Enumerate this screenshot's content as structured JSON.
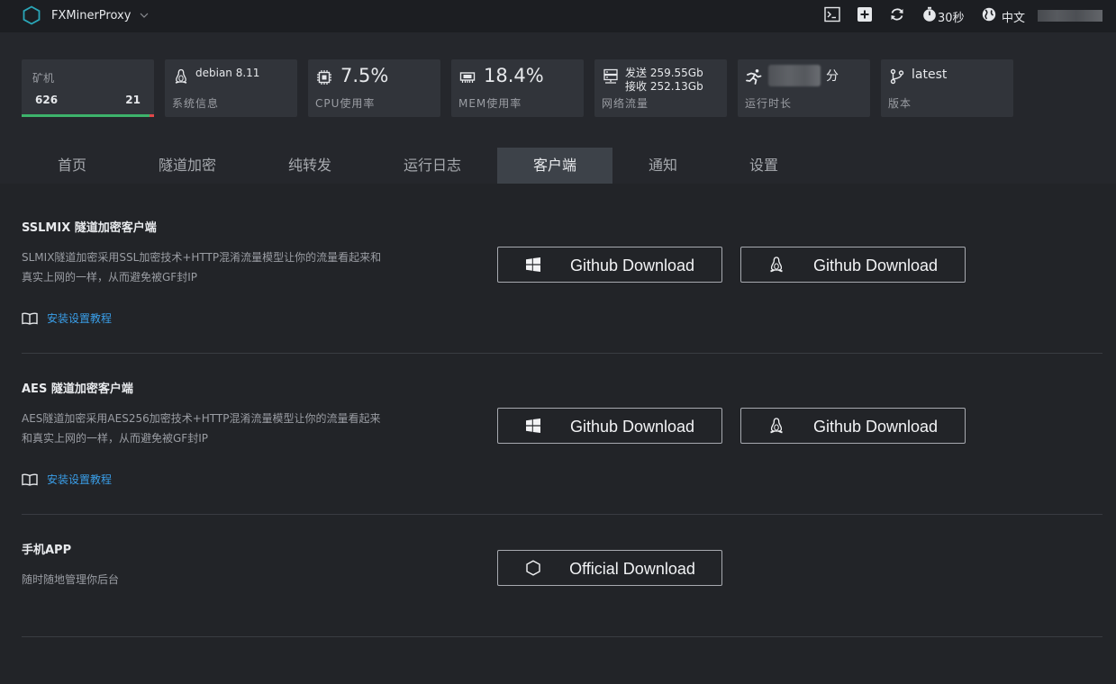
{
  "app": {
    "title": "FXMinerProxy"
  },
  "topbar": {
    "timer_label": "30秒",
    "language_label": "中文",
    "user_name": ""
  },
  "stats": {
    "miners": {
      "label": "矿机",
      "online": "626",
      "offline": "21",
      "online_fraction": 0.9675
    },
    "system": {
      "value": "debian 8.11",
      "label": "系统信息"
    },
    "cpu": {
      "value": "7.5%",
      "label": "CPU使用率"
    },
    "mem": {
      "value": "18.4%",
      "label": "MEM使用率"
    },
    "network": {
      "sent": "发送 259.55Gb",
      "received": "接收 252.13Gb",
      "label": "网络流量"
    },
    "runtime": {
      "unit": "分",
      "label": "运行时长"
    },
    "version": {
      "value": "latest",
      "label": "版本"
    }
  },
  "tabs": [
    {
      "label": "首页"
    },
    {
      "label": "隧道加密"
    },
    {
      "label": "纯转发"
    },
    {
      "label": "运行日志"
    },
    {
      "label": "客户端",
      "active": true
    },
    {
      "label": "通知"
    },
    {
      "label": "设置"
    }
  ],
  "sections": {
    "sslmix": {
      "title": "SSLMIX 隧道加密客户端",
      "desc": "SLMIX隧道加密采用SSL加密技术+HTTP混淆流量模型让你的流量看起来和真实上网的一样，从而避免被GF封IP",
      "tutorial": "安装设置教程",
      "windows_btn": "Github Download",
      "linux_btn": "Github Download"
    },
    "aes": {
      "title": "AES 隧道加密客户端",
      "desc": "AES隧道加密采用AES256加密技术+HTTP混淆流量模型让你的流量看起来和真实上网的一样，从而避免被GF封IP",
      "tutorial": "安装设置教程",
      "windows_btn": "Github Download",
      "linux_btn": "Github Download"
    },
    "app": {
      "title": "手机APP",
      "desc": "随时随地管理你后台",
      "official_btn": "Official Download"
    }
  },
  "colors": {
    "accent_link": "#3a9ee8",
    "online_green": "#3db36b",
    "offline_red": "#e04848",
    "active_tab": "#3d4249"
  }
}
